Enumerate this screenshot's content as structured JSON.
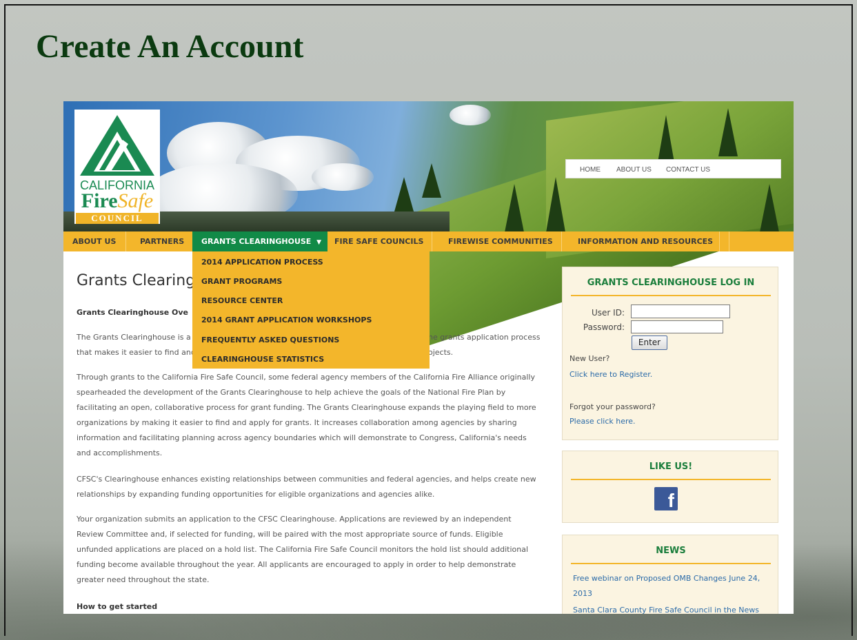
{
  "slide": {
    "title": "Create An Account"
  },
  "logo": {
    "line1": "CALIFORNIA",
    "fire": "Fire",
    "safe": "Safe",
    "council": "COUNCIL"
  },
  "top_nav": [
    "HOME",
    "ABOUT US",
    "CONTACT US"
  ],
  "main_nav": [
    {
      "label": "ABOUT US",
      "active": false
    },
    {
      "label": "PARTNERS",
      "active": false
    },
    {
      "label": "GRANTS CLEARINGHOUSE",
      "active": true
    },
    {
      "label": "FIRE SAFE COUNCILS",
      "active": false
    },
    {
      "label": "FIREWISE COMMUNITIES",
      "active": false
    },
    {
      "label": "INFORMATION AND RESOURCES",
      "active": false
    }
  ],
  "dropdown": [
    "2014 APPLICATION PROCESS",
    "GRANT PROGRAMS",
    "RESOURCE CENTER",
    "2014 GRANT APPLICATION WORKSHOPS",
    "FREQUENTLY ASKED QUESTIONS",
    "CLEARINGHOUSE STATISTICS"
  ],
  "content": {
    "heading": "Grants Clearing",
    "overview_heading": "Grants Clearinghouse Ove",
    "p1_line1_left": "The Grants Clearinghouse is a",
    "p1_line1_right": "he grants application process",
    "p1_line2_left": "that makes it easier to find and",
    "p1_line2_right": "ojects.",
    "p2": "Through grants to the California Fire Safe Council, some federal agency members of the California Fire Alliance originally spearheaded the development of the Grants Clearinghouse to help achieve the goals of the National Fire Plan by facilitating an open, collaborative process for grant funding. The Grants Clearinghouse expands the playing field to more organizations by making it easier to find and apply for grants. It increases collaboration among agencies by sharing information and facilitating planning across agency boundaries which will demonstrate to Congress, California's needs and accomplishments.",
    "p3": "CFSC's Clearinghouse enhances existing relationships between communities and federal agencies, and helps create new relationships by expanding funding opportunities for eligible organizations and agencies alike.",
    "p4": "Your organization submits an application to the CFSC Clearinghouse. Applications are reviewed by an independent Review Committee and, if selected for funding, will be paired with the most appropriate source of funds. Eligible unfunded applications are placed on a hold list. The California Fire Safe Council monitors the hold list should additional funding become available throughout the year. All applicants are encouraged to apply in order to help demonstrate greater need throughout the state.",
    "how_heading": "How to get started"
  },
  "login": {
    "title": "GRANTS CLEARINGHOUSE LOG IN",
    "user_label": "User ID:",
    "password_label": "Password:",
    "user_value": "",
    "password_value": "",
    "enter_label": "Enter",
    "new_user": "New User?",
    "register_link": "Click here to Register.",
    "forgot": "Forgot your password?",
    "forgot_link": "Please click here."
  },
  "like": {
    "title": "LIKE US!",
    "icon": "facebook-icon",
    "icon_glyph": "f"
  },
  "news": {
    "title": "NEWS",
    "items": [
      "Free webinar on Proposed OMB Changes June 24, 2013",
      "Santa Clara County Fire Safe Council in the News"
    ]
  }
}
